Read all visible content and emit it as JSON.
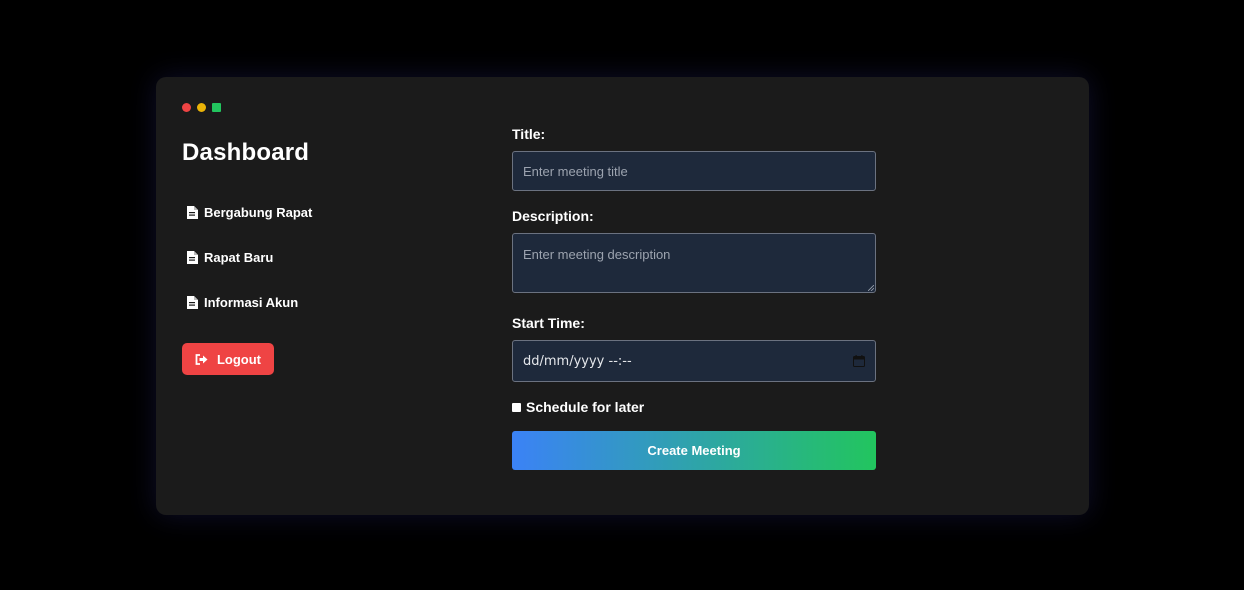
{
  "colors": {
    "card_bg": "#1b1b1b",
    "input_bg": "#1e293b",
    "logout": "#ef4444",
    "gradient_start": "#3b82f6",
    "gradient_end": "#22c55e",
    "dot_red": "#ef4444",
    "dot_yellow": "#eab308",
    "dot_green": "#22c55e"
  },
  "sidebar": {
    "title": "Dashboard",
    "items": [
      {
        "label": "Bergabung Rapat",
        "icon": "document-icon"
      },
      {
        "label": "Rapat Baru",
        "icon": "document-icon"
      },
      {
        "label": "Informasi Akun",
        "icon": "document-icon"
      }
    ],
    "logout_label": "Logout",
    "logout_icon": "sign-out-icon"
  },
  "form": {
    "title_label": "Title:",
    "title_placeholder": "Enter meeting title",
    "description_label": "Description:",
    "description_placeholder": "Enter meeting description",
    "start_time_label": "Start Time:",
    "start_time_value": "dd/mm/yyyy --:--",
    "schedule_label": "Schedule for later",
    "schedule_checked": false,
    "submit_label": "Create Meeting"
  }
}
